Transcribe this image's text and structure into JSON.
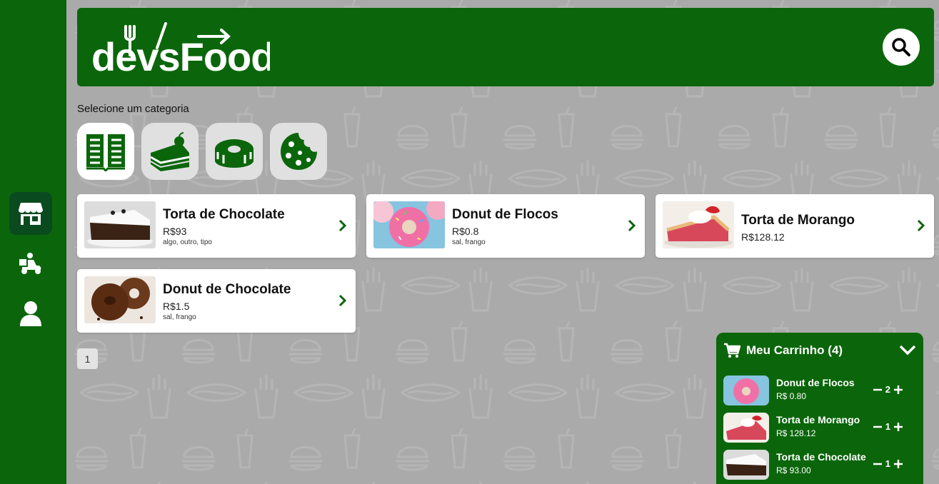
{
  "brand": {
    "logo_text": "devsFood"
  },
  "colors": {
    "primary": "#0b660b",
    "sidebar_active": "#0a4a1f",
    "background": "#aaaaaa"
  },
  "sidebar": {
    "items": [
      {
        "icon": "store-icon",
        "active": true
      },
      {
        "icon": "delivery-icon",
        "active": false
      },
      {
        "icon": "user-icon",
        "active": false
      }
    ]
  },
  "header": {
    "search_icon": "search-icon"
  },
  "categories": {
    "title": "Selecione um categoria",
    "items": [
      {
        "icon": "menu-book-icon",
        "selected": true
      },
      {
        "icon": "cake-icon",
        "selected": false
      },
      {
        "icon": "donut-icon",
        "selected": false
      },
      {
        "icon": "cookie-icon",
        "selected": false
      }
    ]
  },
  "products": [
    {
      "name": "Torta de Chocolate",
      "price": "R$93",
      "ingredients": "algo, outro, tipo"
    },
    {
      "name": "Donut de Flocos",
      "price": "R$0.8",
      "ingredients": "sal, frango"
    },
    {
      "name": "Torta de Morango",
      "price": "R$128.12",
      "ingredients": ""
    },
    {
      "name": "Donut de Chocolate",
      "price": "R$1.5",
      "ingredients": "sal, frango"
    }
  ],
  "pagination": {
    "current": "1"
  },
  "cart": {
    "title": "Meu Carrinho (4)",
    "items": [
      {
        "name": "Donut de Flocos",
        "price": "R$ 0.80",
        "qty": "2"
      },
      {
        "name": "Torta de Morango",
        "price": "R$ 128.12",
        "qty": "1"
      },
      {
        "name": "Torta de Chocolate",
        "price": "R$ 93.00",
        "qty": "1"
      }
    ]
  }
}
